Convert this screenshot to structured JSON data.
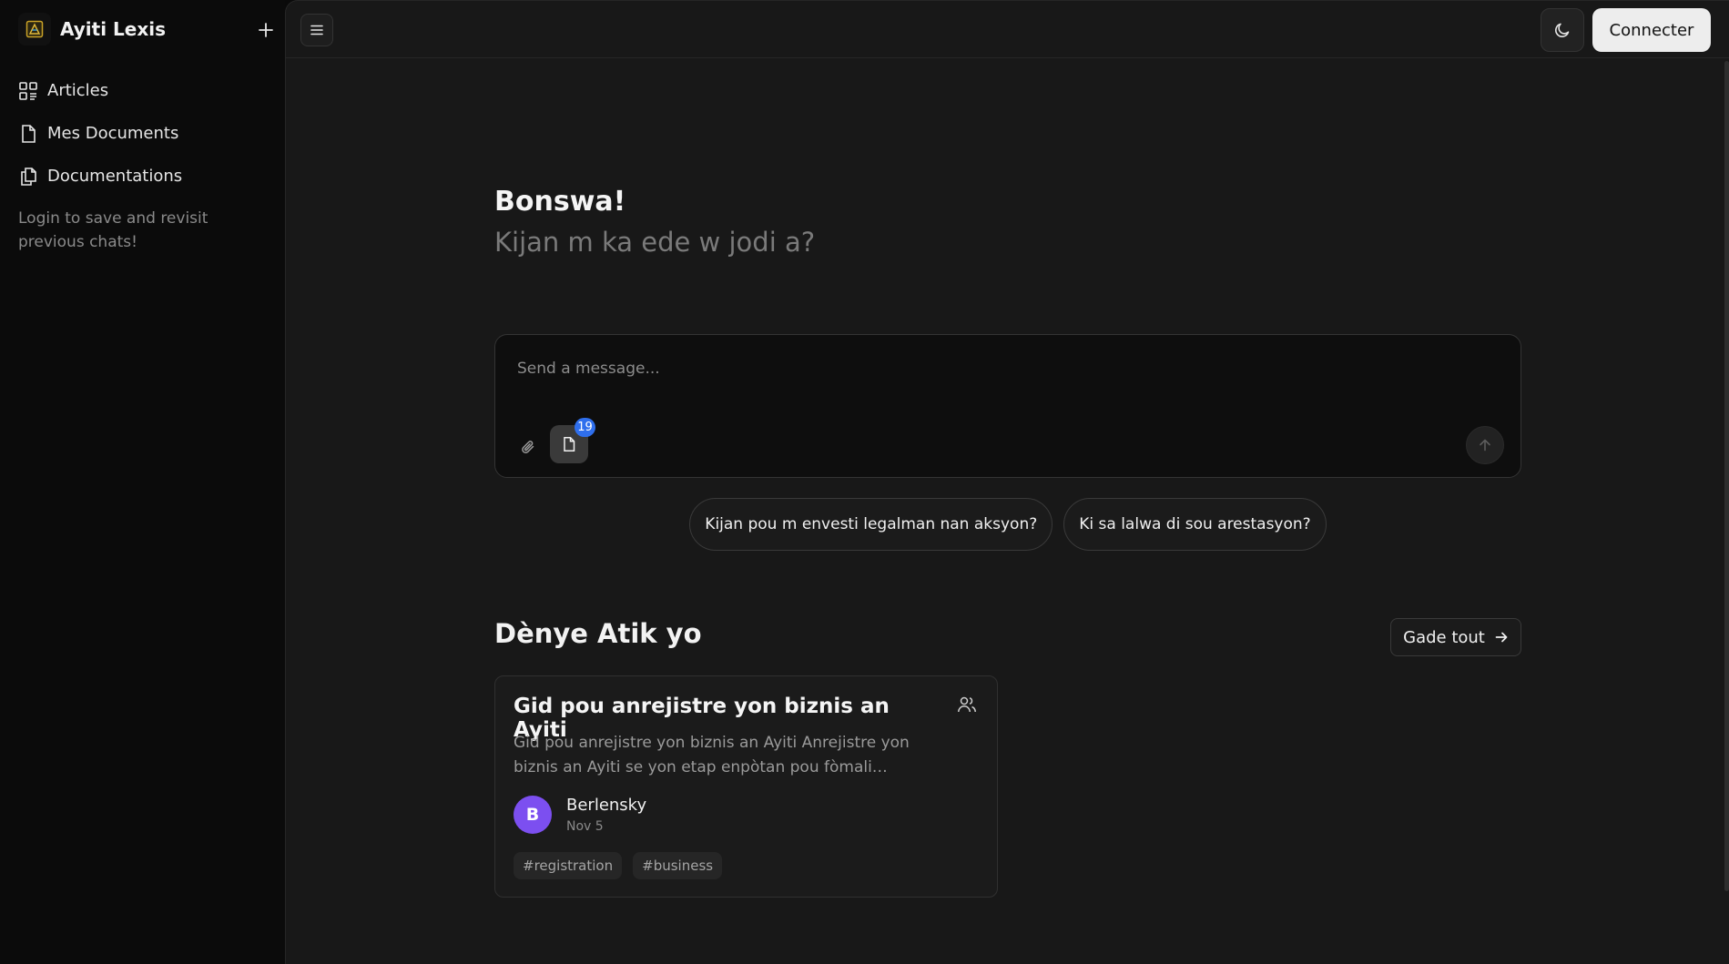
{
  "app": {
    "name": "Ayiti Lexis"
  },
  "sidebar": {
    "items": [
      {
        "label": "Articles",
        "icon": "articles-icon"
      },
      {
        "label": "Mes Documents",
        "icon": "document-icon"
      },
      {
        "label": "Documentations",
        "icon": "documentations-icon"
      }
    ],
    "note": "Login to save and revisit previous chats!"
  },
  "header": {
    "login_label": "Connecter"
  },
  "greeting": {
    "title": "Bonswa!",
    "subtitle": "Kijan m ka ede w jodi a?"
  },
  "composer": {
    "placeholder": "Send a message...",
    "doc_count": "19"
  },
  "suggestions": [
    "Kijan pou m envesti legalman nan aksyon?",
    "Ki sa lalwa di sou arestasyon?"
  ],
  "recent": {
    "title": "Dènye Atik yo",
    "see_all": "Gade tout",
    "articles": [
      {
        "title": "Gid pou anrejistre yon biznis an Ayiti",
        "excerpt": "Gid pou anrejistre yon biznis an Ayiti Anrejistre yon biznis an Ayiti se yon etap enpòtan pou fòmali…",
        "author_initial": "B",
        "author": "Berlensky",
        "date": "Nov 5",
        "tags": [
          "#registration",
          "#business"
        ]
      }
    ]
  },
  "colors": {
    "accent_badge": "#2f6fed",
    "avatar": "#7c4ff0",
    "main_bg": "#181818",
    "sidebar_bg": "#0b0b0b"
  }
}
